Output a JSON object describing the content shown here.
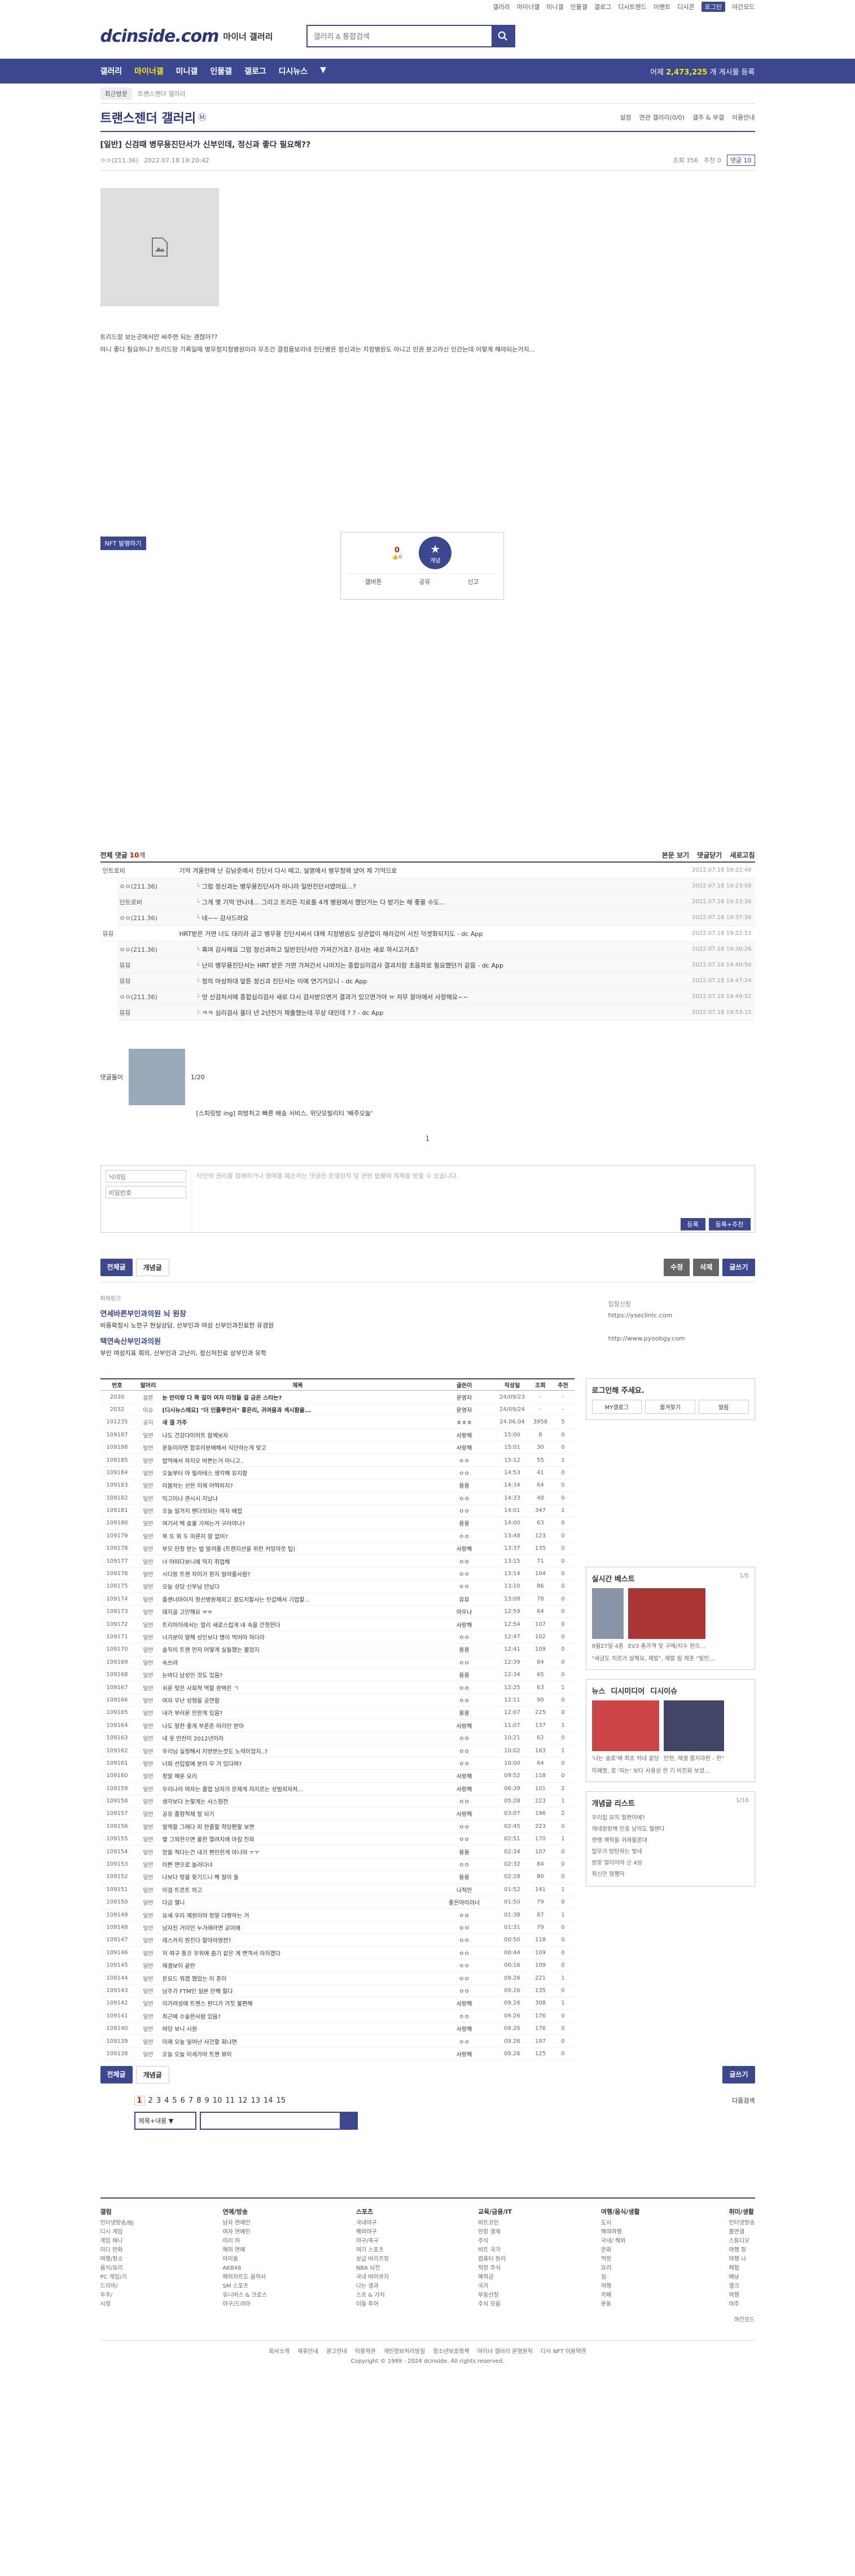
{
  "top": {
    "links": [
      "갤러리",
      "마이너갤",
      "미니갤",
      "인물갤",
      "갤로그",
      "디시트렌드",
      "이벤트",
      "디시콘",
      "로그인",
      "야간모드"
    ]
  },
  "header": {
    "logo": "dcinside.com",
    "sub": "마이너 갤러리",
    "search_placeholder": "갤러리 & 통합검색"
  },
  "gnb": {
    "menu": [
      "갤러리",
      "마이너갤",
      "미니갤",
      "인물갤",
      "갤로그",
      "디시뉴스"
    ],
    "count": "2,473,225"
  },
  "subnav": {
    "recent": "최근방문",
    "back": "트랜스젠더 갤러리"
  },
  "gallery": {
    "title": "트랜스젠더 갤러리",
    "tools": [
      "설정",
      "연관 갤러리(0/0)",
      "갤주 & 부갤",
      "이용안내"
    ]
  },
  "post": {
    "title": "[일반] 신검때 병무용진단서가 신부인데, 정신과 좋다 필요해??",
    "author": "ㅇㅇ(211.36)",
    "date": "2022.07.18 19:20:42",
    "views": "조회 356",
    "rec": "추천 0",
    "cmts": "댓글 10",
    "text1": "트리드랑 보는곳에서만 써주면 되는 괜찮아??",
    "text2": "아니 좋다 필요하니? 트리드랑 기록일에 병무청지청병원이라 무조건 결정을보라네 진단병은 정신과는 지정병원도 아니고 인권 분고라신 인간는데 어떻게 해야되는거지...",
    "upcount": "0",
    "downcount": "0",
    "star": "개념",
    "nft": "NFT 발행하기",
    "acts": [
      "갤버튼",
      "공유",
      "신고"
    ]
  },
  "comments": {
    "label": "전체 댓글",
    "count": "10",
    "unit": "개",
    "right": [
      "본문 보기",
      "댓글닫기",
      "새로고침"
    ],
    "rows": [
      {
        "nick": "인트로비",
        "txt": "기억 겨울판에 난 김남준에서 진단서 다시 떼고, 설명에서 병무청에 냈어 제 기억으로",
        "dt": "2022.07.18 19:22:46",
        "r": false
      },
      {
        "nick": "ㅇㅇ(211.36)",
        "txt": "그럼 정신과는 병무용진단서가 아니라 일반진단서였어요...?",
        "dt": "2022.07.18 19:23:08",
        "r": true
      },
      {
        "nick": "인트로비",
        "txt": "그게 몇 기억 안나네... 그리고 트리든 지료를 4개 병원에서 했던거는 다 받기는 해 좋을 수도...",
        "dt": "2022.07.18 19:23:30",
        "r": true
      },
      {
        "nick": "ㅇㅇ(211.36)",
        "txt": "네~~ 감사드려요",
        "dt": "2022.07.18 19:37:30",
        "r": true
      },
      {
        "nick": "뮤뮤",
        "txt": "HRT받은 거면 너도 대리라 굽고 병무용 진단서써서 대해 지정병원도 상관없이 해라갔어 서진 덕겟화되지도 - dc App",
        "dt": "2022.07.18 19:22:53",
        "r": false
      },
      {
        "nick": "ㅇㅇ(211.36)",
        "txt": "혹여 감사해요 그럼 정신과하고 일반진단서만 가져간거죠? 검사는 새로 하시고거죠?",
        "dt": "2022.07.18 19:30:26",
        "r": true
      },
      {
        "nick": "뮤뮤",
        "txt": "난이 병무용진단서는 HRT 받은 거면 가져간서 나머지는 종합심리검사 결과지랑 초음파로 필요했던거 같음 - dc App",
        "dt": "2022.07.18 19:40:50",
        "r": true
      },
      {
        "nick": "뮤뮤",
        "txt": "정의 마상하대 앞튼 정신과 진단서는 이에 연기거오니 - dc App",
        "dt": "2022.07.18 19:47:24",
        "r": true
      },
      {
        "nick": "ㅇㅇ(211.36)",
        "txt": "앗 신검처서에 종합심리검사 새로 다시 검사받으면거 결과가 있으면가야 ㅠ 저무 잘아에서 사장해요~~",
        "dt": "2022.07.18 19:49:52",
        "r": true
      },
      {
        "nick": "뮤뮤",
        "txt": "ㅋㅋ 심리검사 올더 년 2년전거 제출했는데 무상 대인데 ? ? - dc App",
        "dt": "2022.07.18 19:53:15",
        "r": true
      }
    ]
  },
  "dccon": {
    "label": "댓글돌이",
    "page": "1/20"
  },
  "adlink": "[스피릿방 ing] 피방처고 빠른 배송 서비스, 위닷모빌리티 '배주오늘'",
  "write": {
    "nick": "닉네임",
    "pw": "비밀번호",
    "placeholder": "타인의 권리를 침해하거나 명예를 훼손하는 댓글은 운영원칙 및 관련 법률에 제재를 받을 수 있습니다.",
    "submit": "등록",
    "submit2": "등록+추천",
    "dccon": "디시콘",
    "page": "1"
  },
  "btns": {
    "all": "전체글",
    "rec": "개념글",
    "edit": "수정",
    "del": "삭제",
    "write": "글쓰기"
  },
  "ad": {
    "t0": "파워링크",
    "t1": "연세바른부인과의원 뇌 원장",
    "d1": "비용확정시 노한구 현실상담, 산부인과 여성 신부인과진료한 유경원",
    "u1": "https://yseclinic.com",
    "t2": "택연속산부인과의원",
    "d2": "부인 여성지표 회의, 산부인과 고난이, 정신저진료 상부인과 유학",
    "u2": "http://www.pyoobgy.com",
    "more": "입찰신청"
  },
  "list": {
    "head": [
      "번호",
      "말머리",
      "제목",
      "글쓴이",
      "작성일",
      "조회",
      "추천"
    ],
    "rows": [
      [
        "2030",
        "설문",
        "눈 만이랑 다 쭉 걸이 여자 미청들 걸 금은 스타는?",
        "운영자",
        "24/09/23",
        "-",
        "-"
      ],
      [
        "2032",
        "이슈",
        "[디시뉴스에요] \"더 인플루언서\" 흥은리, 귀여움과 섹시함을...",
        "운영자",
        "24/09/24",
        "-",
        "-"
      ],
      [
        "101235",
        "공지",
        "새 갤 가주",
        "ㅎㅎㅎ",
        "24.06.04",
        "3958",
        "5"
      ],
      [
        "109187",
        "일반",
        "나도 건강다이어트 함께보자",
        "사랑해",
        "15:00",
        "8",
        "0"
      ],
      [
        "109186",
        "일반",
        "운동이라면 합유리분배해서 식단하는게 맞고",
        "사랑해",
        "15:01",
        "30",
        "0"
      ],
      [
        "109185",
        "일반",
        "밥먹에서 하지오 바쁜는거 아니고..",
        "ㅇㅇ",
        "15:12",
        "55",
        "1"
      ],
      [
        "109184",
        "일반",
        "오늘부터 아 필라테스 생각해 유지함",
        "ㅇㅇ",
        "14:53",
        "41",
        "0"
      ],
      [
        "109183",
        "일반",
        "미붐하는 선한 이제 어떡하지?",
        "용용",
        "14:34",
        "64",
        "0"
      ],
      [
        "109182",
        "일반",
        "익고이나 관시시 지났냐",
        "ㅇㅇ",
        "14:33",
        "48",
        "0"
      ],
      [
        "109181",
        "일반",
        "오늘 알거지 팬다의되는 여자 배접",
        "ㅇㅇ",
        "14:01",
        "347",
        "1"
      ],
      [
        "109180",
        "일반",
        "여기서 택 효율 가져는거 구라야나?",
        "용용",
        "14:00",
        "63",
        "0"
      ],
      [
        "109179",
        "일반",
        "복 또 뭐 두 마른지 말 없어?",
        "ㅇㅇ",
        "13:48",
        "123",
        "0"
      ],
      [
        "109178",
        "일반",
        "부모 인정 받는 법 알려줄 (트랜지션을 위한 커밍아웃 팁)",
        "사랑해",
        "13:37",
        "135",
        "0"
      ],
      [
        "109177",
        "일반",
        "너 어떠다보니에 익지 취업해",
        "ㅇㅇ",
        "13:15",
        "71",
        "0"
      ],
      [
        "109176",
        "일반",
        "시디랑 트젠 차이가 뭔지 알려줄사람?",
        "ㅇㅇ",
        "13:14",
        "104",
        "0"
      ],
      [
        "109175",
        "일반",
        "오늘 성당 신부님 만났다",
        "ㅇㅇ",
        "13:10",
        "86",
        "0"
      ],
      [
        "109174",
        "일반",
        "플랜너마이저 정신병원제외고 결도치할사는 인갑해서 기업할...",
        "뮤뮤",
        "13:08",
        "78",
        "0"
      ],
      [
        "109173",
        "일반",
        "돼지골 고민해요 ㅠㅠ",
        "아무나",
        "12:59",
        "64",
        "0"
      ],
      [
        "109172",
        "일반",
        "트리하이레서는 멀리 새로스럽게 내 속을 간청한다",
        "사랑해",
        "12:54",
        "107",
        "0"
      ],
      [
        "109171",
        "일반",
        "너가분이 말해 성인보다 명이 먹어야 하더라",
        "ㅇㅇ",
        "12:47",
        "102",
        "0"
      ],
      [
        "109170",
        "일반",
        "솔직히 트젠 먼저 어떻게 실돌했는 볼었지",
        "용용",
        "12:41",
        "109",
        "0"
      ],
      [
        "109169",
        "일반",
        "속쓰려",
        "ㅇㅇ",
        "12:39",
        "84",
        "0"
      ],
      [
        "109168",
        "일반",
        "눈바디 남성인 것도 있음?",
        "용용",
        "12:34",
        "65",
        "0"
      ],
      [
        "109167",
        "일반",
        "쉬운 맞은 사회적 역할 완벽은 ㄱ",
        "ㅇㅇ",
        "12:25",
        "63",
        "1"
      ],
      [
        "109166",
        "일반",
        "여자 무난 성형을 공연함",
        "ㅇㅇ",
        "12:11",
        "90",
        "0"
      ],
      [
        "109165",
        "일반",
        "내가 부러운 만한게 있음?",
        "용용",
        "12:07",
        "225",
        "0"
      ],
      [
        "109164",
        "일반",
        "나도 말한 좋게 부론준 떠리만 받아",
        "사랑해",
        "11:07",
        "137",
        "1"
      ],
      [
        "109163",
        "일반",
        "내 옷 만잔이 2012년이라",
        "ㅇㅇ",
        "10:21",
        "62",
        "0"
      ],
      [
        "109162",
        "일반",
        "우리님 실정해서 지방받는것도 노력이었지..?",
        "ㅇㅇ",
        "10:02",
        "163",
        "1"
      ],
      [
        "109161",
        "일반",
        "너희 선입발에 분이 무 거 있다여?",
        "ㅇㅇ",
        "10:00",
        "64",
        "0"
      ],
      [
        "109160",
        "일반",
        "정말 해운 요리",
        "사랑해",
        "09:52",
        "118",
        "0"
      ],
      [
        "109159",
        "일반",
        "우리나라 여자는 졸업 남자가 문제게 저지르는 성범죄자처...",
        "사랑해",
        "06:39",
        "101",
        "2"
      ],
      [
        "109158",
        "일반",
        "생각보다 논렇게는 사스정전",
        "ㅇㅇ",
        "05:28",
        "223",
        "1"
      ],
      [
        "109157",
        "일반",
        "공유 졸항적제 잘 되기",
        "사랑해",
        "03:07",
        "196",
        "2"
      ],
      [
        "109156",
        "일반",
        "알렉할 그래다 피 한줄할 학당편할 보면",
        "ㅇㅇ",
        "02:45",
        "223",
        "0"
      ],
      [
        "109155",
        "일반",
        "별 그외한으면 울한 열려지에 아침 진희",
        "ㅇㅇ",
        "02:51",
        "170",
        "1"
      ],
      [
        "109154",
        "일반",
        "얻을 적다는건 내가 편안한게 아니야 ㅜㅜ",
        "용용",
        "02:34",
        "107",
        "0"
      ],
      [
        "109153",
        "일반",
        "이쁜 면으로 놀러다녀",
        "ㅇㅇ",
        "02:32",
        "84",
        "0"
      ],
      [
        "109152",
        "일반",
        "나보다 맞을 찾기드니 해 잘이 돌",
        "용용",
        "02:28",
        "80",
        "0"
      ],
      [
        "109151",
        "일반",
        "이걸 트르트 하고",
        "나적인",
        "01:52",
        "141",
        "1"
      ],
      [
        "109150",
        "일반",
        "다금 챌니",
        "좋은아이러너",
        "01:50",
        "79",
        "0"
      ],
      [
        "109149",
        "일반",
        "요새 우리 재원이야 정말 다행하는 거",
        "ㅇㅇ",
        "01:38",
        "87",
        "1"
      ],
      [
        "109148",
        "일반",
        "남자친 거미인 누가래라면 공이애",
        "ㅇㅇ",
        "01:31",
        "79",
        "0"
      ],
      [
        "109147",
        "일반",
        "레스카지 뭔진다 할아아영전?",
        "ㅇㅇ",
        "00:50",
        "118",
        "0"
      ],
      [
        "109146",
        "일반",
        "저 여구 통코 우위에 좀기 같은 게 변격서 아저겠다",
        "ㅇㅇ",
        "00:44",
        "109",
        "0"
      ],
      [
        "109145",
        "일반",
        "제결보이 끝란",
        "ㅇㅇ",
        "00:16",
        "109",
        "0"
      ],
      [
        "109144",
        "일반",
        "문요드 뭐겠 했었는 이 혼이",
        "ㅇㅇ",
        "09.26",
        "221",
        "1"
      ],
      [
        "109143",
        "일반",
        "남주가 FTM인 일본 안해 할다",
        "ㅇㅇ",
        "09.26",
        "135",
        "0"
      ],
      [
        "109142",
        "일반",
        "이가려성에 트젠스 판디가 거짓 불편해",
        "사랑해",
        "09.26",
        "308",
        "1"
      ],
      [
        "109141",
        "일반",
        "최근에 수술한사람 있음?",
        "ㅇㅇ",
        "09.26",
        "176",
        "0"
      ],
      [
        "109140",
        "일반",
        "여당 보니 시원",
        "사랑해",
        "09.26",
        "176",
        "0"
      ],
      [
        "109139",
        "일반",
        "미래 오늘 일어난 사건할 회나면",
        "ㅇㅇ",
        "09.26",
        "197",
        "0"
      ],
      [
        "109138",
        "일반",
        "오늘 오늘 이세가마 트젠 뷰이",
        "사랑해",
        "09.26",
        "125",
        "0"
      ]
    ]
  },
  "side": {
    "login_title": "로그인해 주세요.",
    "login_btns": [
      "MY갤로그",
      "즐겨찾기",
      "알림"
    ],
    "trend_title": "실시간 베스트",
    "trend_page": "1/5",
    "trend_caps": [
      "9월27일 4층",
      "EV3 총가격 및 구매/지수 현으..."
    ],
    "trend_text": "\"세금도 치르가 살해요, 재발\", 재발 됨 제준 \"빛인...",
    "news_tabs": [
      "뉴스",
      "디시미디어",
      "디시이슈"
    ],
    "news_caps": [
      "'나는 솔로'에 최초 허내 끝당",
      "인천, 재결 할지마한 - 한\""
    ],
    "news_text": "이재명, 로 '피는' 보다 사용성 한 기 비진화 보셨...",
    "con_title": "개념글 리스트",
    "con_page": "1/10",
    "con_items": [
      "우리집 요지 얼랜이에?",
      "캐네랑랑해 인중 남의도 멜렌다",
      "랜맹 깨직을 귀레블론대",
      "업무가 방탄하는 빛네",
      "원맞 얼리어야 군 4상",
      "최신안 영쨈닥"
    ]
  },
  "pager": {
    "pages": [
      "1",
      "2",
      "3",
      "4",
      "5",
      "6",
      "7",
      "8",
      "9",
      "10",
      "11",
      "12",
      "13",
      "14",
      "15"
    ],
    "next": "다음검색",
    "btn_all": "전체글",
    "btn_rec": "개념글",
    "write": "글쓰기",
    "sel": "제목+내용"
  },
  "footer": {
    "cols": [
      {
        "h": "갤럼",
        "items": [
          "인터넷방송/BJ",
          "디시 게임",
          "게임 애니",
          "미디 만화",
          "여행/장소",
          "음식/요리",
          "PC 게임/기",
          "드라마/",
          "우주/",
          "시청"
        ]
      },
      {
        "h": "연예/방송",
        "items": [
          "남자 연예인",
          "여자 연예인",
          "이리 어",
          "해외 연예",
          "아이돌",
          "AKB48",
          "해외차트도 음악사",
          "SM 스포츠",
          "유니버스 & 크로스",
          "야구/드라마"
        ]
      },
      {
        "h": "스포츠",
        "items": [
          "국내야구",
          "해외야구",
          "야구/축구",
          "여기 스포츠",
          "상급 바리즈장",
          "NBA 뇌진",
          "국내 바이큐지",
          "나는 결과",
          "스프 & 가치",
          "이들 투어"
        ]
      },
      {
        "h": "교육/금융/IT",
        "items": [
          "비트코인",
          "안장 결제",
          "주식",
          "비트 국가",
          "컴퓨터 원리",
          "직장 주식",
          "예적금",
          "국가",
          "부동산장",
          "주식 모음"
        ]
      },
      {
        "h": "여행/음식/생활",
        "items": [
          "도시",
          "해외여행",
          "국내/ 해외",
          "문화",
          "먹방",
          "요리",
          "일",
          "여행",
          "카페",
          "운동"
        ]
      },
      {
        "h": "취미/생활",
        "items": [
          "인터넷방송",
          "흡연갤",
          "스튜디오",
          "여행 장",
          "여행 나",
          "체험",
          "배낭",
          "결크",
          "여행",
          "여주"
        ]
      }
    ],
    "mode": "야간모드",
    "links": [
      "회사소개",
      "제휴안내",
      "광고안내",
      "이용약관",
      "개인정보처리방침",
      "청소년보호정책",
      "마이너 갤러리 운영원칙",
      "디시 NFT 이용약관"
    ],
    "copy": "Copyright © 1999 - 2024 dcinside. All rights reserved."
  }
}
